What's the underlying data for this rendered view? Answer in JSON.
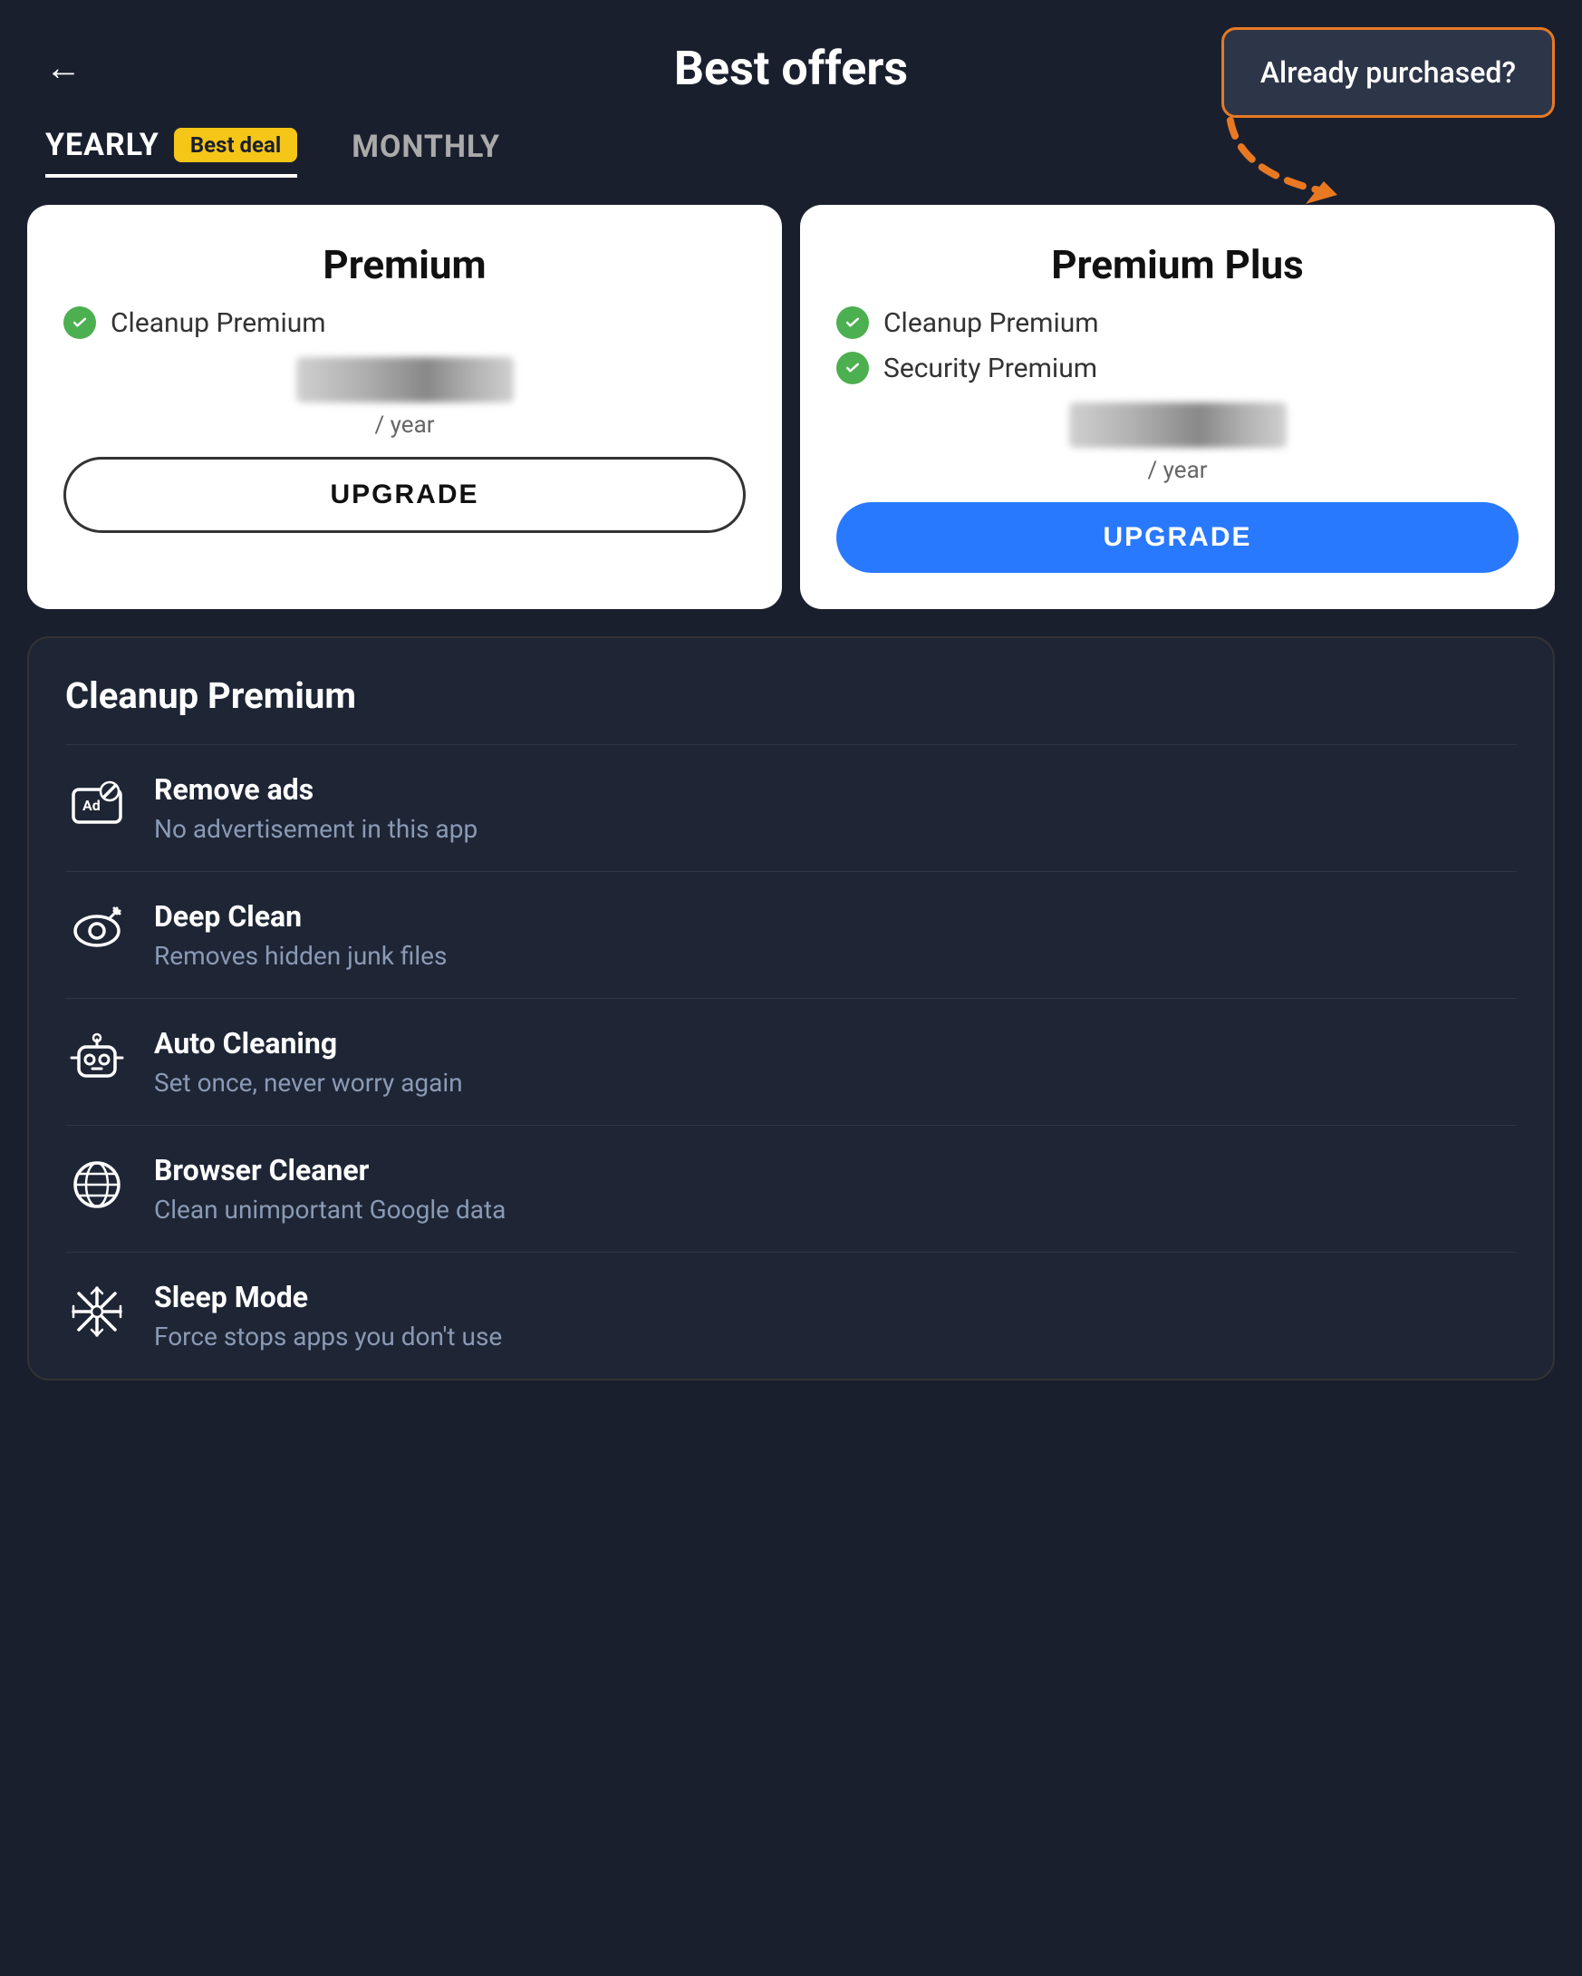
{
  "header": {
    "title": "Best offers",
    "back_label": "←",
    "menu_label": "⋮"
  },
  "tabs": [
    {
      "id": "yearly",
      "label": "YEARLY",
      "badge": "Best deal",
      "active": true
    },
    {
      "id": "monthly",
      "label": "MONTHLY",
      "active": false
    }
  ],
  "plans": [
    {
      "id": "premium",
      "name": "Premium",
      "features": [
        {
          "text": "Cleanup Premium"
        }
      ],
      "price_per": "/ year",
      "upgrade_label": "UPGRADE",
      "primary": false
    },
    {
      "id": "premium_plus",
      "name": "Premium Plus",
      "features": [
        {
          "text": "Cleanup Premium"
        },
        {
          "text": "Security Premium"
        }
      ],
      "price_per": "/ year",
      "upgrade_label": "UPGRADE",
      "primary": true
    }
  ],
  "features_section": {
    "title": "Cleanup Premium",
    "items": [
      {
        "id": "remove-ads",
        "name": "Remove ads",
        "desc": "No advertisement in this app",
        "icon": "ad"
      },
      {
        "id": "deep-clean",
        "name": "Deep Clean",
        "desc": "Removes hidden junk files",
        "icon": "eye"
      },
      {
        "id": "auto-cleaning",
        "name": "Auto Cleaning",
        "desc": "Set once, never worry again",
        "icon": "robot"
      },
      {
        "id": "browser-cleaner",
        "name": "Browser Cleaner",
        "desc": "Clean unimportant Google data",
        "icon": "globe"
      },
      {
        "id": "sleep-mode",
        "name": "Sleep Mode",
        "desc": "Force stops apps you don't use",
        "icon": "snowflake"
      }
    ]
  },
  "already_purchased": {
    "label": "Already purchased?"
  },
  "colors": {
    "accent_orange": "#e87922",
    "accent_blue": "#2979ff",
    "bg_dark": "#1a1f2e",
    "bg_card": "#1e2535",
    "green_check": "#4caf50",
    "badge_yellow": "#f5c518"
  }
}
